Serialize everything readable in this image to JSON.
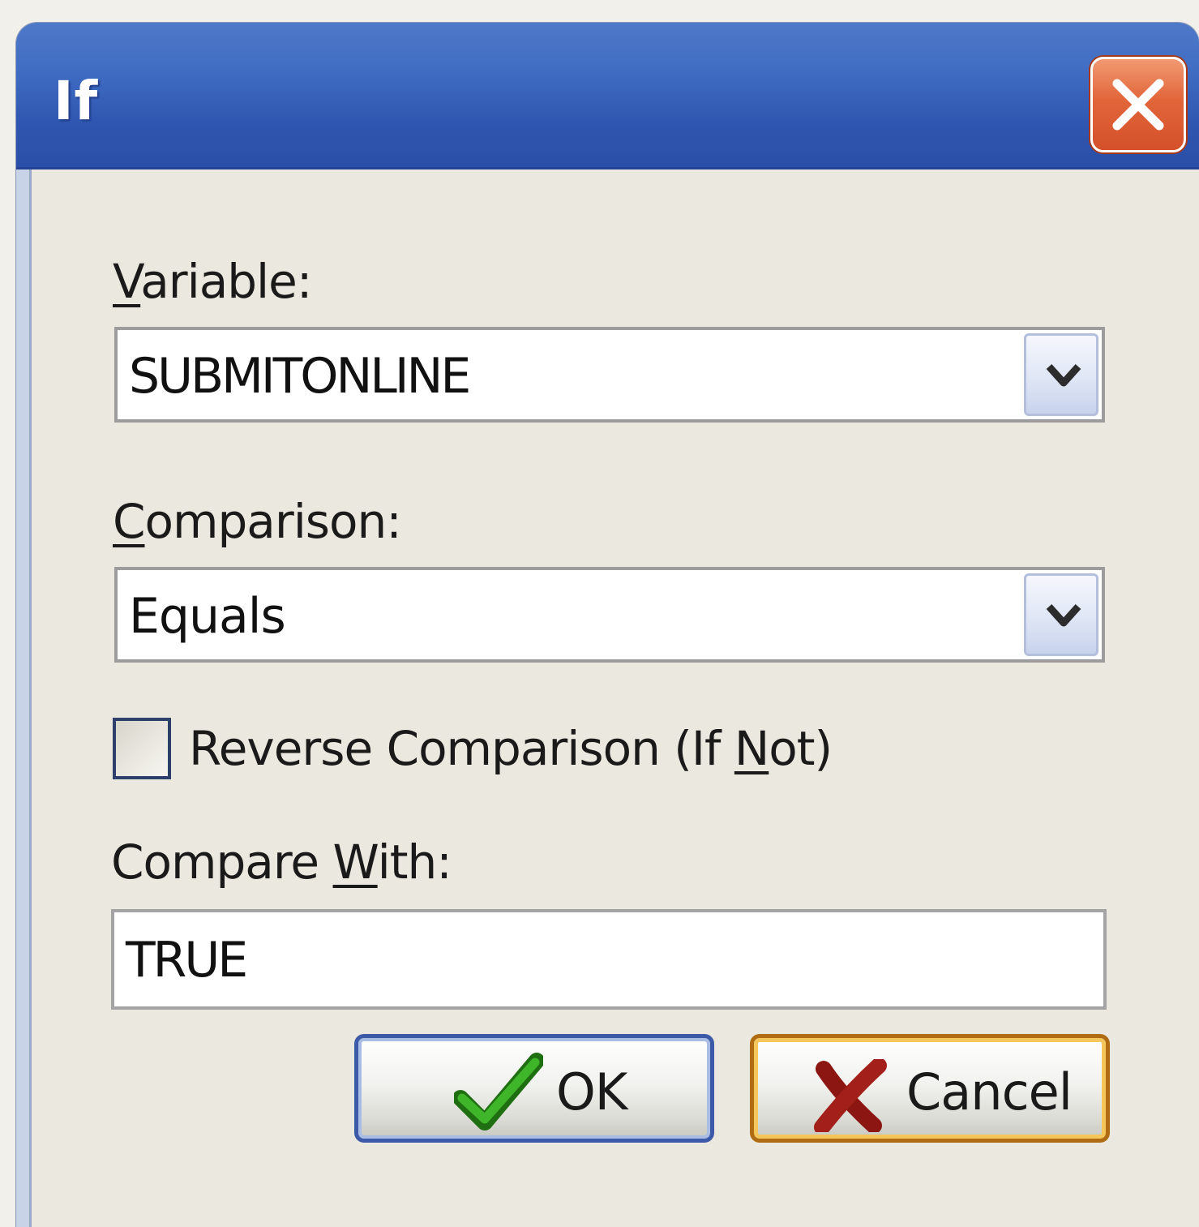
{
  "window": {
    "title": "If"
  },
  "variable": {
    "label_underlined": "V",
    "label_rest": "ariable:",
    "value": "SUBMITONLINE"
  },
  "comparison": {
    "label_underlined": "C",
    "label_rest": "omparison:",
    "value": "Equals"
  },
  "reverse": {
    "label_before": "Reverse Comparison (If ",
    "label_underlined": "N",
    "label_after": "ot)",
    "checked": false
  },
  "compare_with": {
    "label_before": "Compare ",
    "label_underlined": "W",
    "label_after": "ith:",
    "value": "TRUE"
  },
  "buttons": {
    "ok_label": "OK",
    "cancel_label": "Cancel"
  },
  "icons": {
    "close": "close-icon",
    "dropdown": "chevron-down-icon",
    "ok": "checkmark-icon",
    "cancel": "x-mark-icon"
  },
  "colors": {
    "titlebar": "#3f6cc2",
    "close_button": "#e2653a",
    "ok_border": "#3d5aa8",
    "cancel_border": "#b06c12",
    "check_green": "#2e9a1c",
    "x_red": "#a3201a"
  }
}
